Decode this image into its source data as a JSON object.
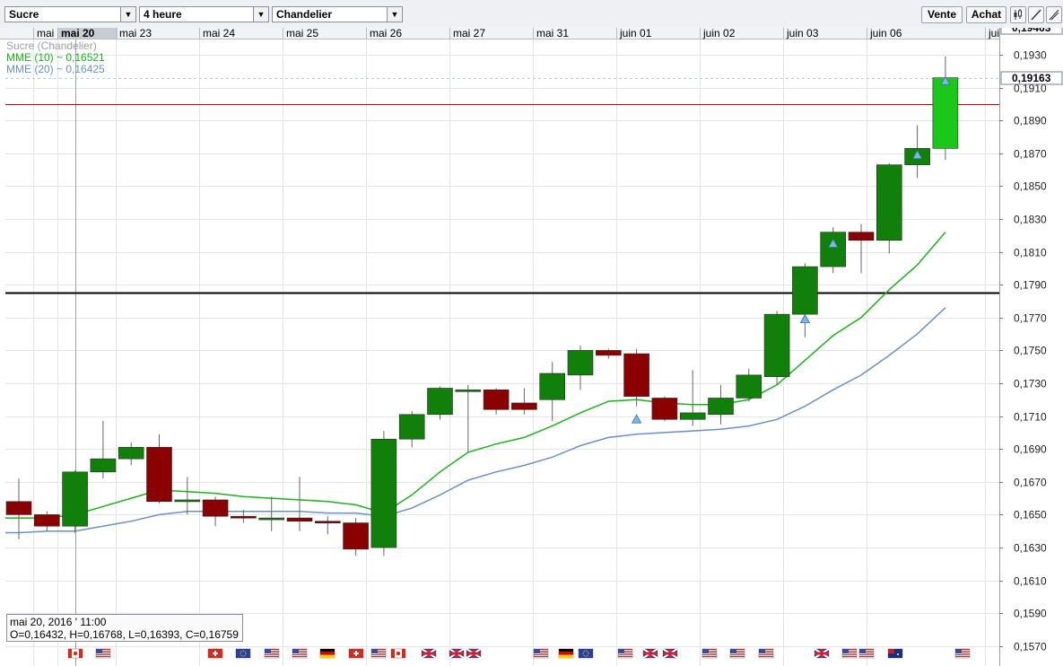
{
  "toolbar": {
    "instrument": "Sucre",
    "period": "4 heure",
    "chart_style": "Chandelier",
    "sell_label": "Vente",
    "buy_label": "Achat",
    "icons": [
      "candle-style-icon",
      "draw-line-icon",
      "crosshair-icon"
    ]
  },
  "legend": {
    "series_label": "Sucre (Chandelier)",
    "mme10_label": "MME (10) ~ 0,16521",
    "mme20_label": "MME (20) ~ 0,16425",
    "colors": {
      "series": "#a0a0a0",
      "mme10": "#18b418",
      "mme20": "#6a8fcc"
    }
  },
  "price_tags": {
    "top": "0,19463",
    "current": "0,19163"
  },
  "info_box": {
    "date": "mai 20, 2016 ' 11:00",
    "ohlc": "O=0,16432, H=0,16768, L=0,16393, C=0,16759"
  },
  "colors": {
    "up": "#10800a",
    "down": "#8b0000",
    "last_up": "#1ac81a",
    "red_line": "#c00000",
    "black_line": "#000000"
  },
  "chart_data": {
    "type": "candlestick",
    "x_axis_labels": [
      "mai",
      "mai 20",
      "mai 23",
      "mai 24",
      "mai 25",
      "mai 26",
      "mai 27",
      "mai 31",
      "juin 01",
      "juin 02",
      "juin 03",
      "juin 06",
      "jui"
    ],
    "highlighted_label": "mai 20",
    "y_ticks": [
      "0,1930",
      "0,1910",
      "0,1890",
      "0,1870",
      "0,1850",
      "0,1830",
      "0,1810",
      "0,1790",
      "0,1770",
      "0,1750",
      "0,1730",
      "0,1710",
      "0,1690",
      "0,1670",
      "0,1650",
      "0,1630",
      "0,1610",
      "0,1590",
      "0,1570"
    ],
    "ylim": [
      0.1565,
      0.1945
    ],
    "candles": [
      {
        "o": 0.1658,
        "h": 0.1672,
        "l": 0.1635,
        "c": 0.165
      },
      {
        "o": 0.165,
        "h": 0.1652,
        "l": 0.164,
        "c": 0.1643
      },
      {
        "o": 0.1643,
        "h": 0.1677,
        "l": 0.1639,
        "c": 0.1676
      },
      {
        "o": 0.1676,
        "h": 0.1707,
        "l": 0.1672,
        "c": 0.1684
      },
      {
        "o": 0.1684,
        "h": 0.1694,
        "l": 0.168,
        "c": 0.1691
      },
      {
        "o": 0.1691,
        "h": 0.1699,
        "l": 0.1657,
        "c": 0.1658
      },
      {
        "o": 0.1659,
        "h": 0.1673,
        "l": 0.165,
        "c": 0.1659
      },
      {
        "o": 0.1659,
        "h": 0.1661,
        "l": 0.1643,
        "c": 0.1649
      },
      {
        "o": 0.1649,
        "h": 0.1653,
        "l": 0.1645,
        "c": 0.1648
      },
      {
        "o": 0.1648,
        "h": 0.1661,
        "l": 0.164,
        "c": 0.1648
      },
      {
        "o": 0.1648,
        "h": 0.1673,
        "l": 0.164,
        "c": 0.1646
      },
      {
        "o": 0.1646,
        "h": 0.1649,
        "l": 0.1638,
        "c": 0.1645
      },
      {
        "o": 0.1645,
        "h": 0.1648,
        "l": 0.1625,
        "c": 0.1629
      },
      {
        "o": 0.163,
        "h": 0.1701,
        "l": 0.1625,
        "c": 0.1696
      },
      {
        "o": 0.1696,
        "h": 0.1713,
        "l": 0.1691,
        "c": 0.1711
      },
      {
        "o": 0.1711,
        "h": 0.1728,
        "l": 0.1708,
        "c": 0.1727
      },
      {
        "o": 0.1726,
        "h": 0.1729,
        "l": 0.1688,
        "c": 0.1726
      },
      {
        "o": 0.1726,
        "h": 0.1727,
        "l": 0.1711,
        "c": 0.1714
      },
      {
        "o": 0.1718,
        "h": 0.1727,
        "l": 0.1711,
        "c": 0.1714
      },
      {
        "o": 0.172,
        "h": 0.1743,
        "l": 0.1707,
        "c": 0.1736
      },
      {
        "o": 0.1735,
        "h": 0.1753,
        "l": 0.1726,
        "c": 0.175
      },
      {
        "o": 0.175,
        "h": 0.1751,
        "l": 0.1745,
        "c": 0.1747
      },
      {
        "o": 0.1748,
        "h": 0.1751,
        "l": 0.1716,
        "c": 0.1722
      },
      {
        "o": 0.1721,
        "h": 0.1722,
        "l": 0.1707,
        "c": 0.1708
      },
      {
        "o": 0.1708,
        "h": 0.1738,
        "l": 0.1704,
        "c": 0.1712
      },
      {
        "o": 0.1711,
        "h": 0.1729,
        "l": 0.1705,
        "c": 0.1721
      },
      {
        "o": 0.1721,
        "h": 0.1739,
        "l": 0.1719,
        "c": 0.1735
      },
      {
        "o": 0.1734,
        "h": 0.1774,
        "l": 0.1729,
        "c": 0.1772
      },
      {
        "o": 0.1772,
        "h": 0.1803,
        "l": 0.1758,
        "c": 0.1801
      },
      {
        "o": 0.1801,
        "h": 0.1825,
        "l": 0.1797,
        "c": 0.1822
      },
      {
        "o": 0.1822,
        "h": 0.1827,
        "l": 0.1797,
        "c": 0.1817
      },
      {
        "o": 0.1817,
        "h": 0.1864,
        "l": 0.1809,
        "c": 0.1863
      },
      {
        "o": 0.1863,
        "h": 0.1887,
        "l": 0.1855,
        "c": 0.1873
      },
      {
        "o": 0.1873,
        "h": 0.1929,
        "l": 0.1866,
        "c": 0.1916
      }
    ],
    "series": [
      {
        "name": "MME (10) ~ 0,16521",
        "values": [
          0.1648,
          0.1648,
          0.165,
          0.1655,
          0.166,
          0.1665,
          0.1664,
          0.1663,
          0.1661,
          0.166,
          0.1659,
          0.1658,
          0.1656,
          0.1651,
          0.1662,
          0.1676,
          0.1688,
          0.1693,
          0.1697,
          0.1704,
          0.1712,
          0.1719,
          0.172,
          0.1718,
          0.1717,
          0.1717,
          0.172,
          0.1729,
          0.1744,
          0.1759,
          0.177,
          0.1787,
          0.1802,
          0.1822
        ]
      },
      {
        "name": "MME (20) ~ 0,16425",
        "values": [
          0.1639,
          0.164,
          0.164,
          0.1643,
          0.1646,
          0.165,
          0.1652,
          0.1652,
          0.1652,
          0.1652,
          0.1652,
          0.1651,
          0.1651,
          0.1649,
          0.1654,
          0.1662,
          0.1671,
          0.1676,
          0.168,
          0.1685,
          0.1692,
          0.1697,
          0.1699,
          0.17,
          0.1701,
          0.1702,
          0.1704,
          0.1708,
          0.1716,
          0.1726,
          0.1735,
          0.1747,
          0.176,
          0.1776
        ]
      }
    ],
    "signals": [
      {
        "index": 22,
        "value": 0.1708
      },
      {
        "index": 28,
        "value": 0.1769
      },
      {
        "index": 29,
        "value": 0.1815
      },
      {
        "index": 32,
        "value": 0.1869
      },
      {
        "index": 33,
        "value": 0.1914
      }
    ],
    "reference_lines": [
      {
        "value": 0.19,
        "color": "#c00000"
      },
      {
        "value": 0.1785,
        "color": "#000000"
      }
    ],
    "dashed_level": 0.1916,
    "grid": true,
    "legend_position": "top-left",
    "flags": [
      {
        "x": 2,
        "type": "ca"
      },
      {
        "x": 3,
        "type": "us"
      },
      {
        "x": 7,
        "type": "ch"
      },
      {
        "x": 8,
        "type": "eu"
      },
      {
        "x": 9,
        "type": "us"
      },
      {
        "x": 10,
        "type": "us"
      },
      {
        "x": 11,
        "type": "de"
      },
      {
        "x": 12,
        "type": "ch"
      },
      {
        "x": 12.8,
        "type": "us"
      },
      {
        "x": 13.5,
        "type": "ca"
      },
      {
        "x": 14.6,
        "type": "gb"
      },
      {
        "x": 15.6,
        "type": "gb"
      },
      {
        "x": 16.2,
        "type": "gb"
      },
      {
        "x": 18.6,
        "type": "us"
      },
      {
        "x": 19.5,
        "type": "de"
      },
      {
        "x": 20.2,
        "type": "eu"
      },
      {
        "x": 21.6,
        "type": "us"
      },
      {
        "x": 22.5,
        "type": "gb"
      },
      {
        "x": 23.2,
        "type": "gb"
      },
      {
        "x": 24.6,
        "type": "us"
      },
      {
        "x": 25.6,
        "type": "us"
      },
      {
        "x": 26.6,
        "type": "us"
      },
      {
        "x": 28.6,
        "type": "gb"
      },
      {
        "x": 29.6,
        "type": "us"
      },
      {
        "x": 30.2,
        "type": "us"
      },
      {
        "x": 31.2,
        "type": "au"
      },
      {
        "x": 33.6,
        "type": "us"
      }
    ]
  }
}
